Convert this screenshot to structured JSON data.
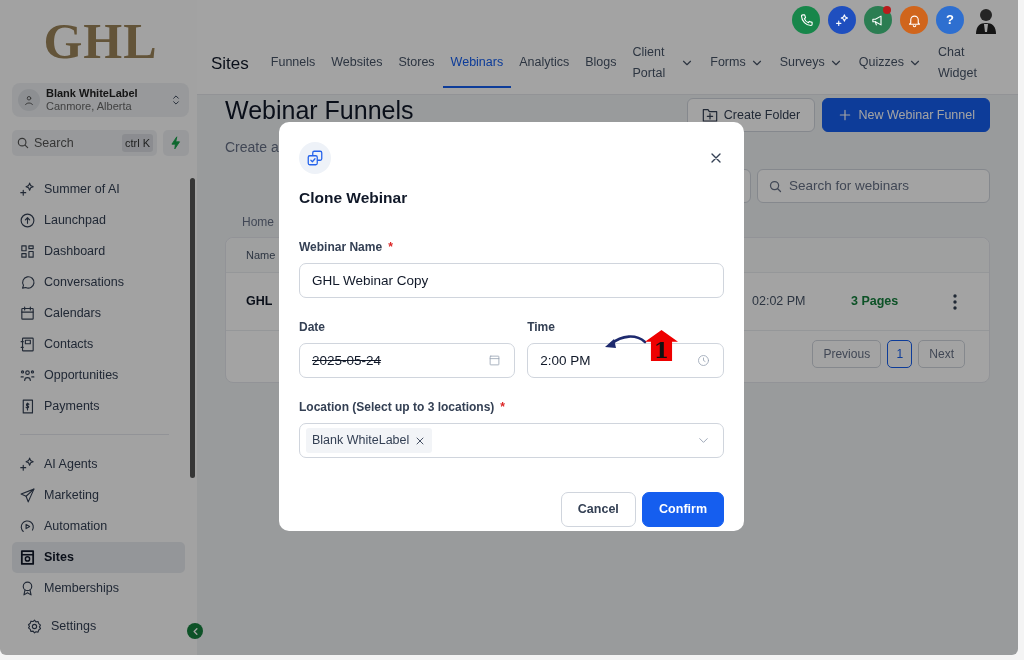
{
  "logo": "GHL",
  "account": {
    "name": "Blank WhiteLabel",
    "location": "Canmore, Alberta"
  },
  "search": {
    "placeholder": "Search",
    "shortcut": "ctrl K"
  },
  "sidebar": {
    "groups": [
      [
        {
          "label": "Summer of AI",
          "kind": "sparkle",
          "selected": false
        },
        {
          "label": "Launchpad",
          "kind": "rocket",
          "selected": false
        },
        {
          "label": "Dashboard",
          "kind": "grid",
          "selected": false
        },
        {
          "label": "Conversations",
          "kind": "chat",
          "selected": false
        },
        {
          "label": "Calendars",
          "kind": "calendar",
          "selected": false
        },
        {
          "label": "Contacts",
          "kind": "contact",
          "selected": false
        },
        {
          "label": "Opportunities",
          "kind": "people",
          "selected": false
        },
        {
          "label": "Payments",
          "kind": "dollar",
          "selected": false
        }
      ],
      [
        {
          "label": "AI Agents",
          "kind": "sparkle",
          "selected": false
        },
        {
          "label": "Marketing",
          "kind": "send",
          "selected": false
        },
        {
          "label": "Automation",
          "kind": "play",
          "selected": false
        },
        {
          "label": "Sites",
          "kind": "site",
          "selected": true
        },
        {
          "label": "Memberships",
          "kind": "award",
          "selected": false
        }
      ]
    ],
    "settings": "Settings"
  },
  "header": {
    "title": "Sites",
    "tabs": [
      {
        "label": "Funnels",
        "selected": false,
        "dropdown": false
      },
      {
        "label": "Websites",
        "selected": false,
        "dropdown": false
      },
      {
        "label": "Stores",
        "selected": false,
        "dropdown": false
      },
      {
        "label": "Webinars",
        "selected": true,
        "dropdown": false
      },
      {
        "label": "Analytics",
        "selected": false,
        "dropdown": false
      },
      {
        "label": "Blogs",
        "selected": false,
        "dropdown": false
      },
      {
        "label": "Client Portal",
        "selected": false,
        "dropdown": true
      },
      {
        "label": "Forms",
        "selected": false,
        "dropdown": true
      },
      {
        "label": "Surveys",
        "selected": false,
        "dropdown": true
      },
      {
        "label": "Quizzes",
        "selected": false,
        "dropdown": true
      },
      {
        "label": "Chat Widget",
        "selected": false,
        "dropdown": false
      }
    ],
    "actions": [
      {
        "kind": "phone",
        "color": "#17864a",
        "dot": false
      },
      {
        "kind": "sparkle",
        "color": "#1f4fbf",
        "dot": false
      },
      {
        "kind": "megaphone",
        "color": "#2b7d52",
        "dot": true
      },
      {
        "kind": "bell",
        "color": "#d0651c",
        "dot": false
      },
      {
        "kind": "help",
        "color": "#2e6fd0",
        "dot": false,
        "label": "?"
      },
      {
        "kind": "avatar"
      }
    ]
  },
  "page": {
    "title": "Webinar Funnels",
    "subtitle": "Create a",
    "buttons": [
      {
        "label": "Create Folder",
        "kind": "secondary"
      },
      {
        "label": "New Webinar Funnel",
        "kind": "primary"
      }
    ],
    "search_placeholder": "Search for webinars",
    "breadcrumb": "Home",
    "table": {
      "columns": [
        "Name"
      ],
      "rows": [
        {
          "name": "GHL",
          "updated": "02:02 PM",
          "pages": "3 Pages"
        }
      ]
    },
    "pagination": {
      "previous": "Previous",
      "pages": [
        {
          "label": "1",
          "selected": true
        }
      ],
      "next": "Next"
    }
  },
  "modal": {
    "title": "Clone Webinar",
    "rows": [
      [
        {
          "label": "Webinar Name",
          "required_mark": "*",
          "kind": "text",
          "value": "GHL Webinar Copy"
        }
      ],
      [
        {
          "label": "Date",
          "kind": "date",
          "value": "2025-05-24",
          "struck": true
        },
        {
          "label": "Time",
          "kind": "time",
          "value": "2:00 PM"
        }
      ],
      [
        {
          "label": "Location (Select up to 3 locations)",
          "required_mark": "*",
          "kind": "multiselect",
          "chips": [
            "Blank WhiteLabel"
          ]
        }
      ]
    ],
    "buttons": [
      {
        "label": "Cancel",
        "kind": "secondary"
      },
      {
        "label": "Confirm",
        "kind": "primary"
      }
    ]
  },
  "annotation": {
    "label": "1"
  }
}
